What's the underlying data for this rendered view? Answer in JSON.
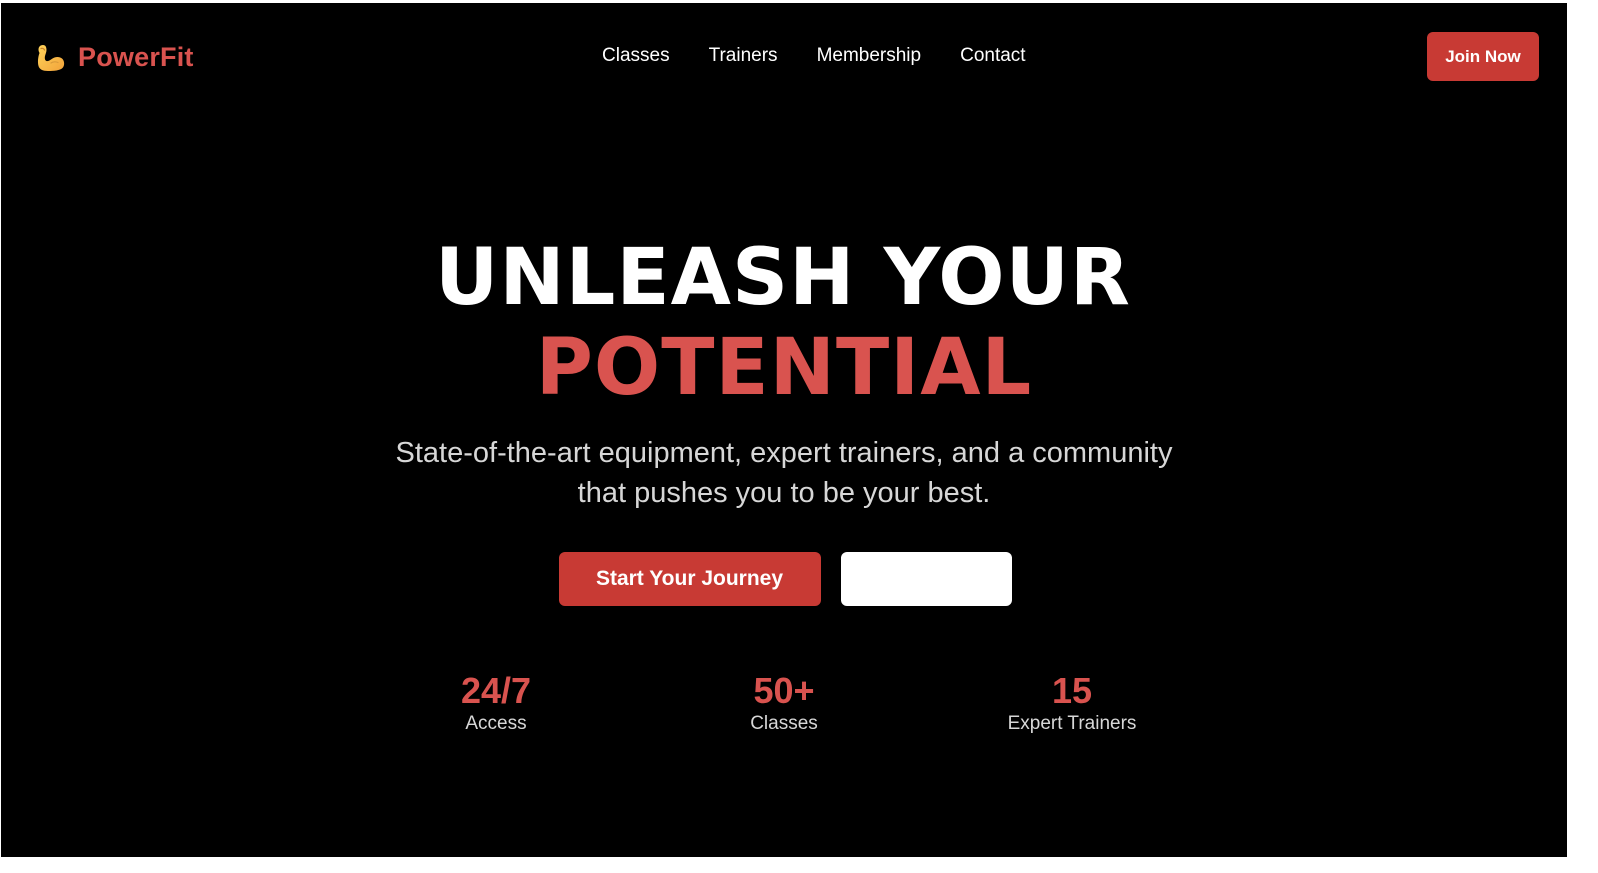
{
  "brand": {
    "name": "PowerFit",
    "icon": "flexed-biceps-icon",
    "color": "#d9534f"
  },
  "nav": {
    "links": [
      "Classes",
      "Trainers",
      "Membership",
      "Contact"
    ]
  },
  "header": {
    "join_label": "Join Now"
  },
  "hero": {
    "title_line1": "UNLEASH YOUR",
    "title_line2": "POTENTIAL",
    "subtitle": "State-of-the-art equipment, expert trainers, and a community that pushes you to be your best.",
    "primary_cta": "Start Your Journey",
    "secondary_cta": ""
  },
  "stats": [
    {
      "value": "24/7",
      "label": "Access"
    },
    {
      "value": "50+",
      "label": "Classes"
    },
    {
      "value": "15",
      "label": "Expert Trainers"
    }
  ],
  "colors": {
    "accent": "#d9534f",
    "button": "#c83a34",
    "background": "#000000"
  }
}
